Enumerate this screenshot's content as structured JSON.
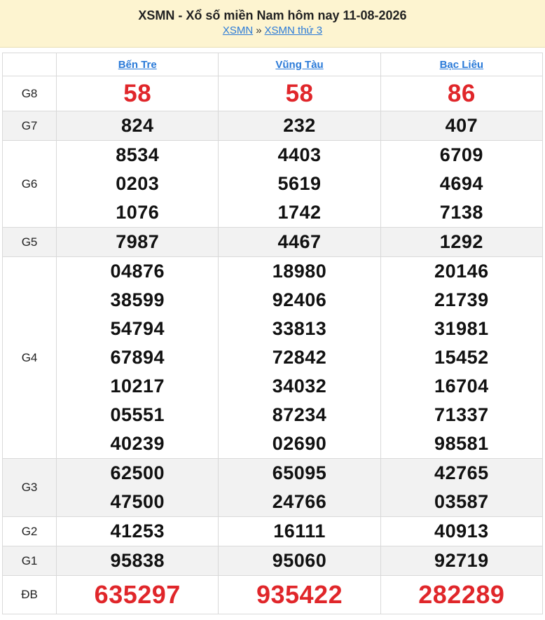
{
  "header": {
    "title": "XSMN - Xổ số miền Nam hôm nay 11-08-2026",
    "crumb_1": "XSMN",
    "crumb_sep": "»",
    "crumb_2": "XSMN thứ 3"
  },
  "provinces": [
    "Bến Tre",
    "Vũng Tàu",
    "Bạc Liêu"
  ],
  "colors": {
    "accent_red": "#e0262a",
    "link_blue": "#2a7ad8",
    "header_bg": "#fdf4d0"
  },
  "prizes": [
    {
      "label": "G8",
      "values": [
        [
          "58"
        ],
        [
          "58"
        ],
        [
          "86"
        ]
      ]
    },
    {
      "label": "G7",
      "values": [
        [
          "824"
        ],
        [
          "232"
        ],
        [
          "407"
        ]
      ]
    },
    {
      "label": "G6",
      "values": [
        [
          "8534",
          "0203",
          "1076"
        ],
        [
          "4403",
          "5619",
          "1742"
        ],
        [
          "6709",
          "4694",
          "7138"
        ]
      ]
    },
    {
      "label": "G5",
      "values": [
        [
          "7987"
        ],
        [
          "4467"
        ],
        [
          "1292"
        ]
      ]
    },
    {
      "label": "G4",
      "values": [
        [
          "04876",
          "38599",
          "54794",
          "67894",
          "10217",
          "05551",
          "40239"
        ],
        [
          "18980",
          "92406",
          "33813",
          "72842",
          "34032",
          "87234",
          "02690"
        ],
        [
          "20146",
          "21739",
          "31981",
          "15452",
          "16704",
          "71337",
          "98581"
        ]
      ]
    },
    {
      "label": "G3",
      "values": [
        [
          "62500",
          "47500"
        ],
        [
          "65095",
          "24766"
        ],
        [
          "42765",
          "03587"
        ]
      ]
    },
    {
      "label": "G2",
      "values": [
        [
          "41253"
        ],
        [
          "16111"
        ],
        [
          "40913"
        ]
      ]
    },
    {
      "label": "G1",
      "values": [
        [
          "95838"
        ],
        [
          "95060"
        ],
        [
          "92719"
        ]
      ]
    },
    {
      "label": "ĐB",
      "values": [
        [
          "635297"
        ],
        [
          "935422"
        ],
        [
          "282289"
        ]
      ]
    }
  ]
}
